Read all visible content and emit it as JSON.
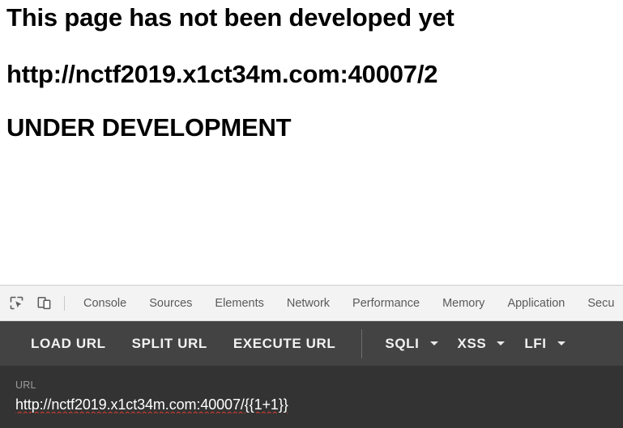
{
  "page": {
    "headings": [
      "This page has not been developed yet",
      "http://nctf2019.x1ct34m.com:40007/2",
      "UNDER DEVELOPMENT"
    ]
  },
  "devtools": {
    "icons": [
      {
        "name": "inspect-element-icon",
        "title": "Inspect element"
      },
      {
        "name": "device-toolbar-icon",
        "title": "Toggle device toolbar"
      }
    ],
    "tabs": [
      {
        "label": "Console"
      },
      {
        "label": "Sources"
      },
      {
        "label": "Elements"
      },
      {
        "label": "Network"
      },
      {
        "label": "Performance"
      },
      {
        "label": "Memory"
      },
      {
        "label": "Application"
      },
      {
        "label": "Secu"
      }
    ]
  },
  "hackbar": {
    "buttons": [
      {
        "label": "LOAD URL"
      },
      {
        "label": "SPLIT URL"
      },
      {
        "label": "EXECUTE URL"
      }
    ],
    "menus": [
      {
        "label": "SQLI",
        "caret": "chevron-down-icon"
      },
      {
        "label": "XSS",
        "caret": "chevron-down-icon"
      },
      {
        "label": "LFI",
        "caret": "chevron-down-icon"
      }
    ],
    "url_field": {
      "label": "URL",
      "value": "http://nctf2019.x1ct34m.com:40007/{{1+1}}",
      "placeholder": "URL"
    }
  },
  "colors": {
    "page_background": "#ffffff",
    "page_text": "#000000",
    "devtools_tabbar_background": "#f3f3f3",
    "devtools_tab_text": "#5a5a5a",
    "hackbar_toolbar_background": "#434343",
    "hackbar_url_background": "#333333",
    "hackbar_button_text": "#f2f2f2",
    "hackbar_label_text": "#9b9b9b",
    "spellcheck_underline": "#e23a2e"
  }
}
